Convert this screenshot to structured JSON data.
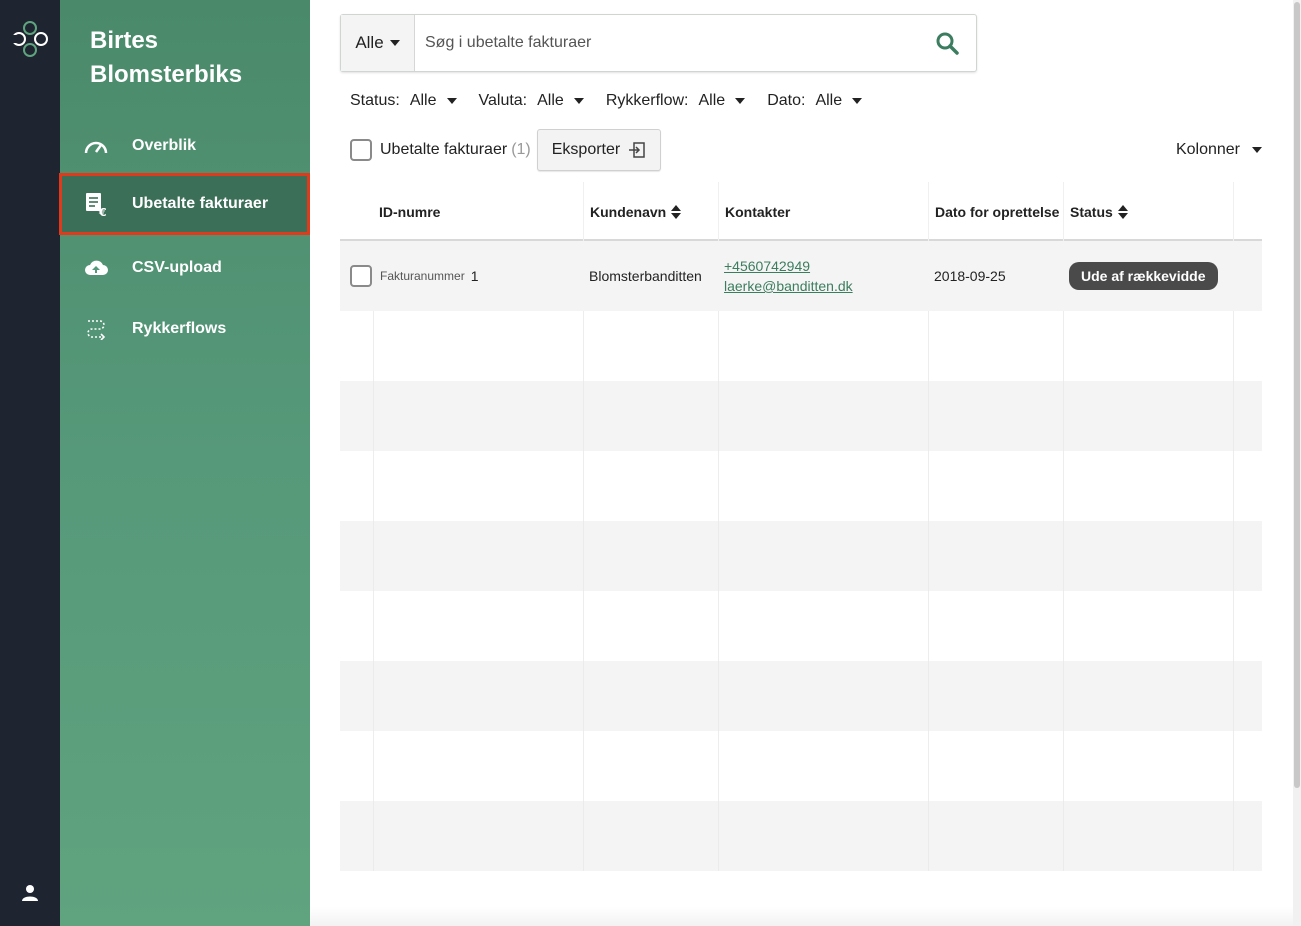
{
  "rail": {
    "logo_icon": "clover-logo-icon",
    "user_icon": "user-icon"
  },
  "sidebar": {
    "brand_line1": "Birtes",
    "brand_line2": "Blomsterbiks",
    "items": [
      {
        "label": "Overblik",
        "icon": "speedometer-icon",
        "active": false
      },
      {
        "label": "Ubetalte fakturaer",
        "icon": "invoice-euro-icon",
        "active": true
      },
      {
        "label": "CSV-upload",
        "icon": "cloud-upload-icon",
        "active": false
      },
      {
        "label": "Rykkerflows",
        "icon": "flow-icon",
        "active": false
      }
    ],
    "active_border_color": "#e03a1c"
  },
  "search": {
    "scope": "Alle",
    "placeholder": "Søg i ubetalte fakturaer"
  },
  "filters": [
    {
      "label": "Status:",
      "value": "Alle"
    },
    {
      "label": "Valuta:",
      "value": "Alle"
    },
    {
      "label": "Rykkerflow:",
      "value": "Alle"
    },
    {
      "label": "Dato:",
      "value": "Alle"
    }
  ],
  "toolbar": {
    "select_label": "Ubetalte fakturaer",
    "select_count": "(1)",
    "export_label": "Eksporter",
    "columns_label": "Kolonner"
  },
  "table": {
    "columns": [
      {
        "label": "ID-numre",
        "sortable": false
      },
      {
        "label": "Kundenavn",
        "sortable": true
      },
      {
        "label": "Kontakter",
        "sortable": false
      },
      {
        "label": "Dato for oprettelse",
        "sortable": false
      },
      {
        "label": "Status",
        "sortable": true
      }
    ],
    "rows": [
      {
        "id_label": "Fakturanummer",
        "id_value": "1",
        "customer": "Blomsterbanditten",
        "phone": "+4560742949",
        "email": "laerke@banditten.dk",
        "created": "2018-09-25",
        "status": "Ude af rækkevidde"
      }
    ]
  },
  "colors": {
    "sidebar_green": "#56997a",
    "rail_dark": "#1e2430",
    "link_green": "#3b7d5e",
    "badge_dark": "#4a4a4a"
  }
}
